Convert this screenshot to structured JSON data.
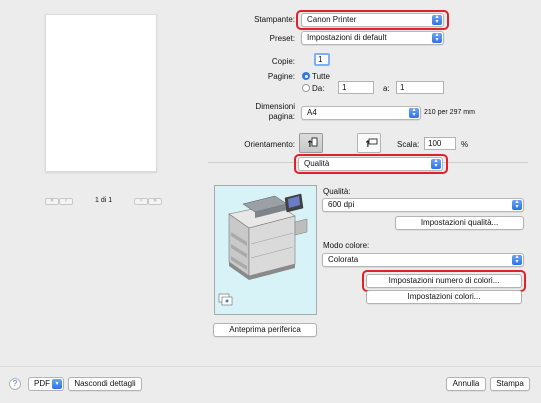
{
  "preview": {
    "page_indicator": "1 di 1",
    "nav_first": "«",
    "nav_prev": "‹",
    "nav_next": "›",
    "nav_last": "»"
  },
  "printer": {
    "label": "Stampante:",
    "value": "Canon Printer"
  },
  "preset": {
    "label": "Preset:",
    "value": "Impostazioni di default"
  },
  "copies": {
    "label": "Copie:",
    "value": "1"
  },
  "pages": {
    "label": "Pagine:",
    "all_label": "Tutte",
    "from_label": "Da:",
    "from_value": "1",
    "to_label": "a:",
    "to_value": "1"
  },
  "paper_size": {
    "label_line1": "Dimensioni",
    "label_line2": "pagina:",
    "value": "A4",
    "dims": "210 per 297 mm"
  },
  "orientation": {
    "label": "Orientamento:"
  },
  "scale": {
    "label": "Scala:",
    "value": "100",
    "unit": "%"
  },
  "section": {
    "value": "Qualità"
  },
  "quality": {
    "label": "Qualità:",
    "value": "600 dpi",
    "settings_button": "Impostazioni qualità..."
  },
  "color_mode": {
    "label": "Modo colore:",
    "value": "Colorata",
    "color_count_button": "Impostazioni numero di colori...",
    "color_settings_button": "Impostazioni colori..."
  },
  "device_preview_button": "Anteprima periferica",
  "footer": {
    "help": "?",
    "pdf": "PDF",
    "hide_details": "Nascondi dettagli",
    "cancel": "Annulla",
    "print": "Stampa"
  },
  "colors": {
    "accent": "#2f7ae5",
    "highlight": "#e0202a",
    "preview_bg": "#d8f3f7"
  }
}
